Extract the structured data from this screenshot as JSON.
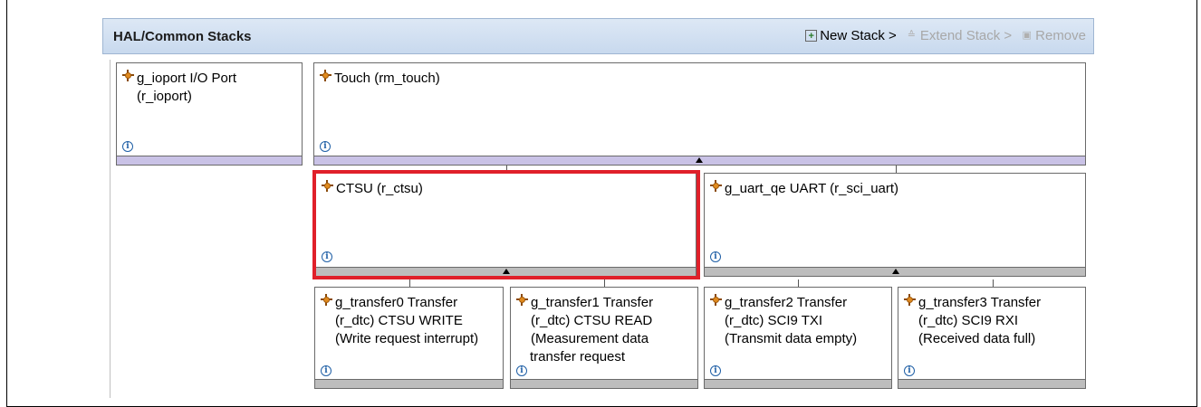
{
  "panel": {
    "title": "HAL/Common Stacks",
    "toolbar": {
      "new_stack": "New Stack >",
      "extend_stack": "Extend Stack >",
      "remove": "Remove"
    }
  },
  "modules": {
    "ioport": {
      "line1": "g_ioport I/O Port",
      "line2": "(r_ioport)"
    },
    "touch": {
      "line1": "Touch (rm_touch)"
    },
    "ctsu": {
      "line1": "CTSU (r_ctsu)"
    },
    "uart": {
      "line1": "g_uart_qe UART (r_sci_uart)"
    },
    "transfer0": {
      "line1": "g_transfer0 Transfer",
      "line2": "(r_dtc) CTSU WRITE",
      "line3": "(Write request interrupt)"
    },
    "transfer1": {
      "line1": "g_transfer1 Transfer",
      "line2": "(r_dtc) CTSU READ",
      "line3": "(Measurement data",
      "line4": "transfer request"
    },
    "transfer2": {
      "line1": "g_transfer2 Transfer",
      "line2": "(r_dtc) SCI9 TXI",
      "line3": "(Transmit data empty)"
    },
    "transfer3": {
      "line1": "g_transfer3 Transfer",
      "line2": "(r_dtc) SCI9 RXI",
      "line3": "(Received data full)"
    }
  },
  "icons": {
    "info": "i",
    "module": "module-icon",
    "new_stack": "new-stack-icon",
    "extend_stack": "extend-stack-icon",
    "remove": "remove-icon"
  },
  "colors": {
    "header_bg": "#c8d9ee",
    "highlight": "#e0202a",
    "expanded_bar": "#c9c2e6",
    "collapsed_bar": "#bdbdbd",
    "module_icon": "#e08a1e",
    "info_icon": "#1f5fa6"
  }
}
